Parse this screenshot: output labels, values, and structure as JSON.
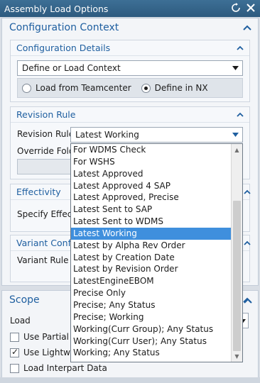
{
  "window": {
    "title": "Assembly Load Options"
  },
  "configuration_context": {
    "title": "Configuration Context",
    "details": {
      "title": "Configuration Details",
      "select_value": "Define or Load Context",
      "radio": [
        {
          "label": "Load from Teamcenter",
          "selected": false
        },
        {
          "label": "Define in NX",
          "selected": true
        }
      ]
    },
    "revision_rule": {
      "title": "Revision Rule",
      "label": "Revision Rule",
      "value": "Latest Working",
      "override_label": "Override Folde"
    },
    "effectivity": {
      "title": "Effectivity",
      "specify_label": "Specify Effecti"
    },
    "variant": {
      "title": "Variant Config",
      "label": "Variant Rule"
    }
  },
  "scope": {
    "title": "Scope",
    "load_label": "Load",
    "checkboxes": [
      {
        "label": "Use Partial Lo",
        "checked": false
      },
      {
        "label": "Use Lightwei",
        "checked": true
      },
      {
        "label": "Load Interpart Data",
        "checked": false
      }
    ]
  },
  "dropdown": {
    "items": [
      "For WDMS Check",
      "For WSHS",
      "Latest Approved",
      "Latest Approved 4 SAP",
      "Latest Approved, Precise",
      "Latest Sent to SAP",
      "Latest Sent to WDMS",
      "Latest Working",
      "Latest by Alpha Rev Order",
      "Latest by Creation Date",
      "Latest by Revision Order",
      "LatestEngineEBOM",
      "Precise Only",
      "Precise; Any Status",
      "Precise; Working",
      "Working(Curr Group); Any Status",
      "Working(Curr User); Any Status",
      "Working; Any Status"
    ],
    "selected_index": 7
  },
  "colors": {
    "accent": "#1f5fa0",
    "titlebar": "#2d5a7f",
    "selection": "#3f8fdd"
  }
}
